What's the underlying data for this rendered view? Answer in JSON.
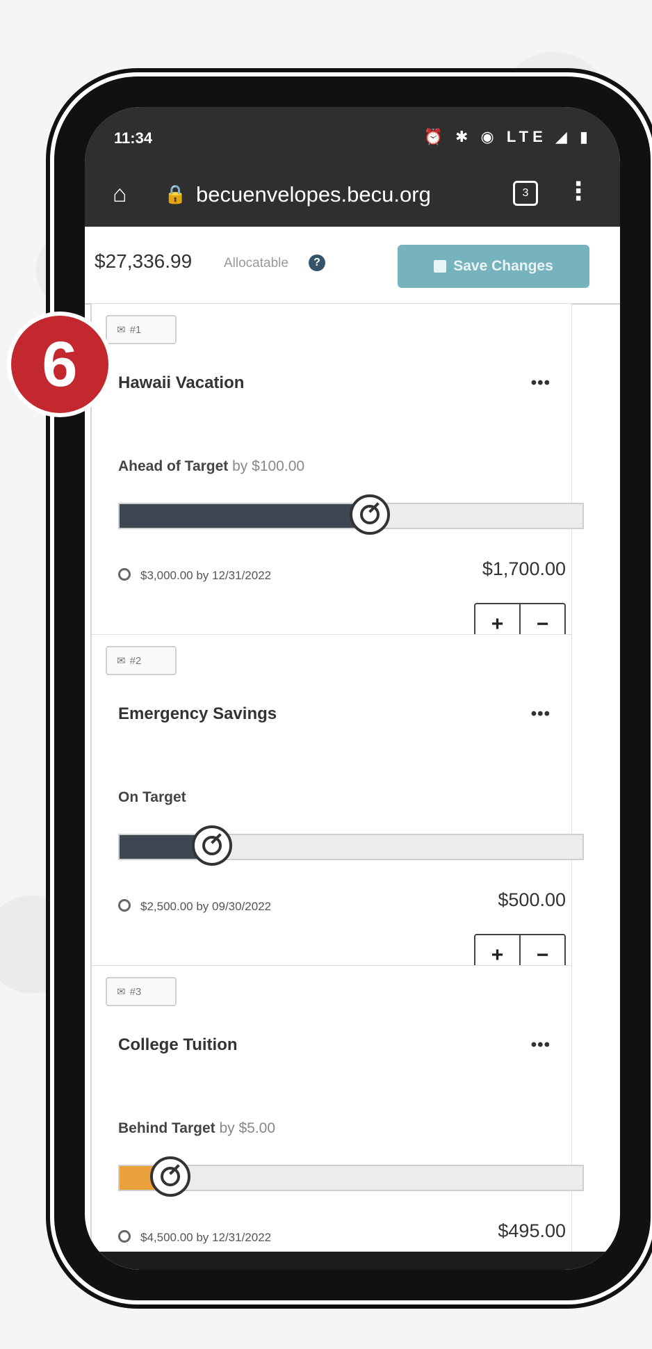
{
  "status_bar": {
    "time": "11:34",
    "icons": "⏰ ✱ ◉ LTE ◢ ▮"
  },
  "browser": {
    "url": "becuenvelopes.becu.org",
    "tab_count": "3"
  },
  "allocatable": {
    "amount": "$27,336.99",
    "label": "Allocatable",
    "help": "?"
  },
  "save_button": {
    "label": "Save Changes"
  },
  "step_badge": "6",
  "envelopes": [
    {
      "tag": "#1",
      "name": "Hawaii Vacation",
      "status_word": "Ahead of Target",
      "status_rest": " by $100.00",
      "progress": 0.54,
      "fill_color": "#3e4651",
      "target": "$3,000.00 by 12/31/2022",
      "balance": "$1,700.00",
      "more": "•••",
      "plus": "+",
      "minus": "−"
    },
    {
      "tag": "#2",
      "name": "Emergency Savings",
      "status_word": "On Target",
      "status_rest": "",
      "progress": 0.2,
      "fill_color": "#3e4651",
      "target": "$2,500.00 by 09/30/2022",
      "balance": "$500.00",
      "more": "•••",
      "plus": "+",
      "minus": "−"
    },
    {
      "tag": "#3",
      "name": "College Tuition",
      "status_word": "Behind Target",
      "status_rest": " by $5.00",
      "progress": 0.11,
      "fill_color": "#e9a23b",
      "target": "$4,500.00 by 12/31/2022",
      "balance": "$495.00",
      "more": "•••",
      "plus": "+",
      "minus": "−"
    }
  ]
}
